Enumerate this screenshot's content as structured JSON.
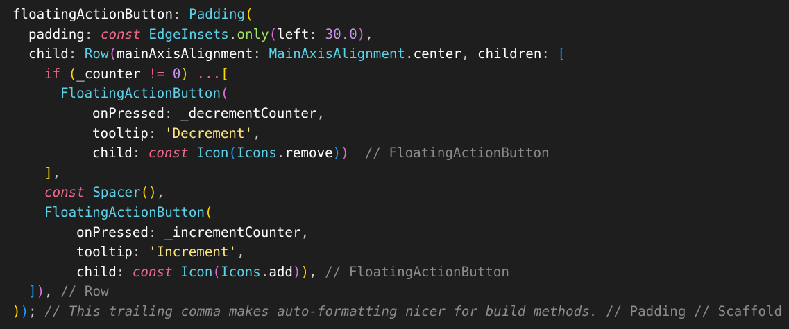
{
  "editor": {
    "theme": {
      "background": "#1e1e1e",
      "property": "#ffffff",
      "keyword": "#f06a8d",
      "class": "#5cd1e8",
      "method": "#a6e267",
      "number": "#c792ea",
      "string": "#ffe57f",
      "comment": "#8b8b8b"
    },
    "lines": [
      {
        "tokens": [
          {
            "t": "floatingActionButton",
            "c": "prop"
          },
          {
            "t": ": ",
            "c": "punct"
          },
          {
            "t": "Padding",
            "c": "class"
          },
          {
            "t": "(",
            "c": "paren"
          }
        ]
      },
      {
        "tokens": [
          {
            "t": "padding",
            "c": "prop"
          },
          {
            "t": ": ",
            "c": "punct"
          },
          {
            "t": "const",
            "c": "keyword"
          },
          {
            "t": " ",
            "c": "text"
          },
          {
            "t": "EdgeInsets",
            "c": "class"
          },
          {
            "t": ".",
            "c": "punct"
          },
          {
            "t": "only",
            "c": "method"
          },
          {
            "t": "(",
            "c": "paren2"
          },
          {
            "t": "left",
            "c": "prop"
          },
          {
            "t": ": ",
            "c": "punct"
          },
          {
            "t": "30.0",
            "c": "number"
          },
          {
            "t": ")",
            "c": "paren2"
          },
          {
            "t": ",",
            "c": "punct"
          }
        ]
      },
      {
        "tokens": [
          {
            "t": "child",
            "c": "prop"
          },
          {
            "t": ": ",
            "c": "punct"
          },
          {
            "t": "Row",
            "c": "class"
          },
          {
            "t": "(",
            "c": "paren2"
          },
          {
            "t": "mainAxisAlignment",
            "c": "prop"
          },
          {
            "t": ": ",
            "c": "punct"
          },
          {
            "t": "MainAxisAlignment",
            "c": "class"
          },
          {
            "t": ".",
            "c": "punct"
          },
          {
            "t": "center",
            "c": "prop"
          },
          {
            "t": ", ",
            "c": "punct"
          },
          {
            "t": "children",
            "c": "prop"
          },
          {
            "t": ": ",
            "c": "punct"
          },
          {
            "t": "[",
            "c": "paren3"
          }
        ]
      },
      {
        "tokens": [
          {
            "t": "if",
            "c": "control"
          },
          {
            "t": " ",
            "c": "text"
          },
          {
            "t": "(",
            "c": "paren"
          },
          {
            "t": "_counter",
            "c": "text"
          },
          {
            "t": " != ",
            "c": "op"
          },
          {
            "t": "0",
            "c": "number"
          },
          {
            "t": ")",
            "c": "paren"
          },
          {
            "t": " ...",
            "c": "op"
          },
          {
            "t": "[",
            "c": "paren"
          }
        ]
      },
      {
        "tokens": [
          {
            "t": "FloatingActionButton",
            "c": "class"
          },
          {
            "t": "(",
            "c": "paren2"
          }
        ]
      },
      {
        "tokens": [
          {
            "t": "onPressed",
            "c": "prop"
          },
          {
            "t": ": ",
            "c": "punct"
          },
          {
            "t": "_decrementCounter",
            "c": "text"
          },
          {
            "t": ",",
            "c": "punct"
          }
        ]
      },
      {
        "tokens": [
          {
            "t": "tooltip",
            "c": "prop"
          },
          {
            "t": ": ",
            "c": "punct"
          },
          {
            "t": "'Decrement'",
            "c": "string"
          },
          {
            "t": ",",
            "c": "punct"
          }
        ]
      },
      {
        "tokens": [
          {
            "t": "child",
            "c": "prop"
          },
          {
            "t": ": ",
            "c": "punct"
          },
          {
            "t": "const",
            "c": "keyword"
          },
          {
            "t": " ",
            "c": "text"
          },
          {
            "t": "Icon",
            "c": "class"
          },
          {
            "t": "(",
            "c": "paren3"
          },
          {
            "t": "Icons",
            "c": "class"
          },
          {
            "t": ".",
            "c": "punct"
          },
          {
            "t": "remove",
            "c": "prop"
          },
          {
            "t": ")",
            "c": "paren3"
          },
          {
            "t": ")",
            "c": "paren2"
          },
          {
            "t": "  // FloatingActionButton",
            "c": "hint"
          }
        ]
      },
      {
        "tokens": [
          {
            "t": "]",
            "c": "paren"
          },
          {
            "t": ",",
            "c": "punct"
          }
        ]
      },
      {
        "tokens": [
          {
            "t": "const",
            "c": "keyword"
          },
          {
            "t": " ",
            "c": "text"
          },
          {
            "t": "Spacer",
            "c": "class"
          },
          {
            "t": "(",
            "c": "paren"
          },
          {
            "t": ")",
            "c": "paren"
          },
          {
            "t": ",",
            "c": "punct"
          }
        ]
      },
      {
        "tokens": [
          {
            "t": "FloatingActionButton",
            "c": "class"
          },
          {
            "t": "(",
            "c": "paren"
          }
        ]
      },
      {
        "tokens": [
          {
            "t": "onPressed",
            "c": "prop"
          },
          {
            "t": ": ",
            "c": "punct"
          },
          {
            "t": "_incrementCounter",
            "c": "text"
          },
          {
            "t": ",",
            "c": "punct"
          }
        ]
      },
      {
        "tokens": [
          {
            "t": "tooltip",
            "c": "prop"
          },
          {
            "t": ": ",
            "c": "punct"
          },
          {
            "t": "'Increment'",
            "c": "string"
          },
          {
            "t": ",",
            "c": "punct"
          }
        ]
      },
      {
        "tokens": [
          {
            "t": "child",
            "c": "prop"
          },
          {
            "t": ": ",
            "c": "punct"
          },
          {
            "t": "const",
            "c": "keyword"
          },
          {
            "t": " ",
            "c": "text"
          },
          {
            "t": "Icon",
            "c": "class"
          },
          {
            "t": "(",
            "c": "paren2"
          },
          {
            "t": "Icons",
            "c": "class"
          },
          {
            "t": ".",
            "c": "punct"
          },
          {
            "t": "add",
            "c": "prop"
          },
          {
            "t": ")",
            "c": "paren2"
          },
          {
            "t": ")",
            "c": "paren"
          },
          {
            "t": ", ",
            "c": "punct"
          },
          {
            "t": "// FloatingActionButton",
            "c": "hint"
          }
        ]
      },
      {
        "tokens": [
          {
            "t": "]",
            "c": "paren3"
          },
          {
            "t": ")",
            "c": "paren2"
          },
          {
            "t": ", ",
            "c": "punct"
          },
          {
            "t": "// Row",
            "c": "hint"
          }
        ]
      },
      {
        "tokens": [
          {
            "t": ")",
            "c": "paren"
          },
          {
            "t": ")",
            "c": "paren3"
          },
          {
            "t": ";",
            "c": "punct"
          },
          {
            "t": " // This trailing comma makes auto-formatting nicer for build methods.",
            "c": "comment-it"
          },
          {
            "t": " // Padding // Scaffold",
            "c": "hint"
          }
        ]
      }
    ]
  }
}
